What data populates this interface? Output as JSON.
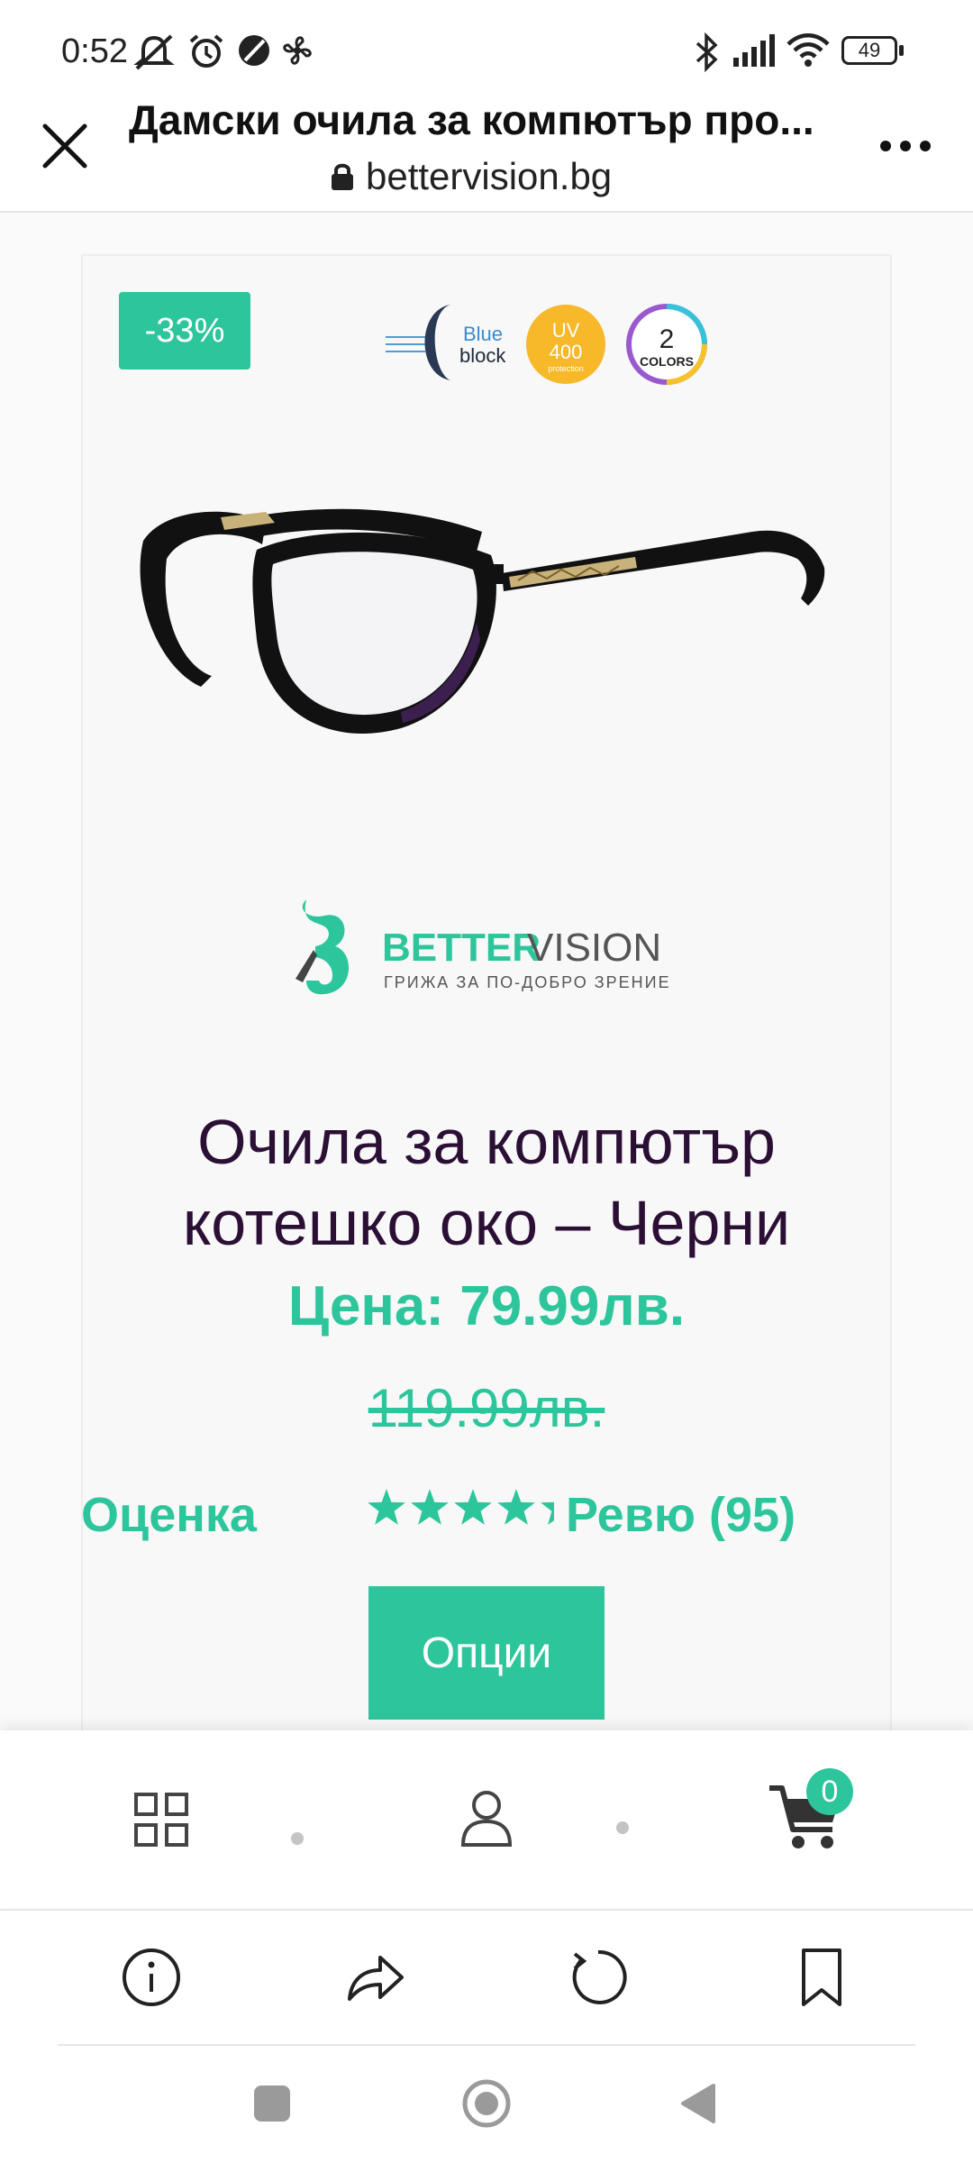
{
  "status_bar": {
    "time": "0:52",
    "battery": "49"
  },
  "browser": {
    "title": "Дамски очила за компютър про...",
    "url": "bettervision.bg"
  },
  "product": {
    "discount": "-33%",
    "name_line1": "Очила за компютър",
    "name_line2": "котешко око – Черни",
    "price": "Цена: 79.99лв.",
    "old_price": "119.99лв.",
    "rating_label": "Оценка",
    "rating_stars": 4.5,
    "reviews": "Ревю (95)",
    "options_button": "Опции"
  },
  "feature_badges": {
    "blue_block_line1": "Blue",
    "blue_block_line2": "block",
    "uv_line1": "UV",
    "uv_line2": "400",
    "uv_line3": "protection",
    "colors_num": "2",
    "colors_text": "COLORS"
  },
  "brand": {
    "name_better": "BETTER",
    "name_vision": "VISION",
    "tagline": "ГРИЖА ЗА ПО-ДОБРО ЗРЕНИЕ"
  },
  "site_nav": {
    "cart_count": "0"
  },
  "colors": {
    "accent": "#2dc59b",
    "title": "#2b0f35"
  }
}
